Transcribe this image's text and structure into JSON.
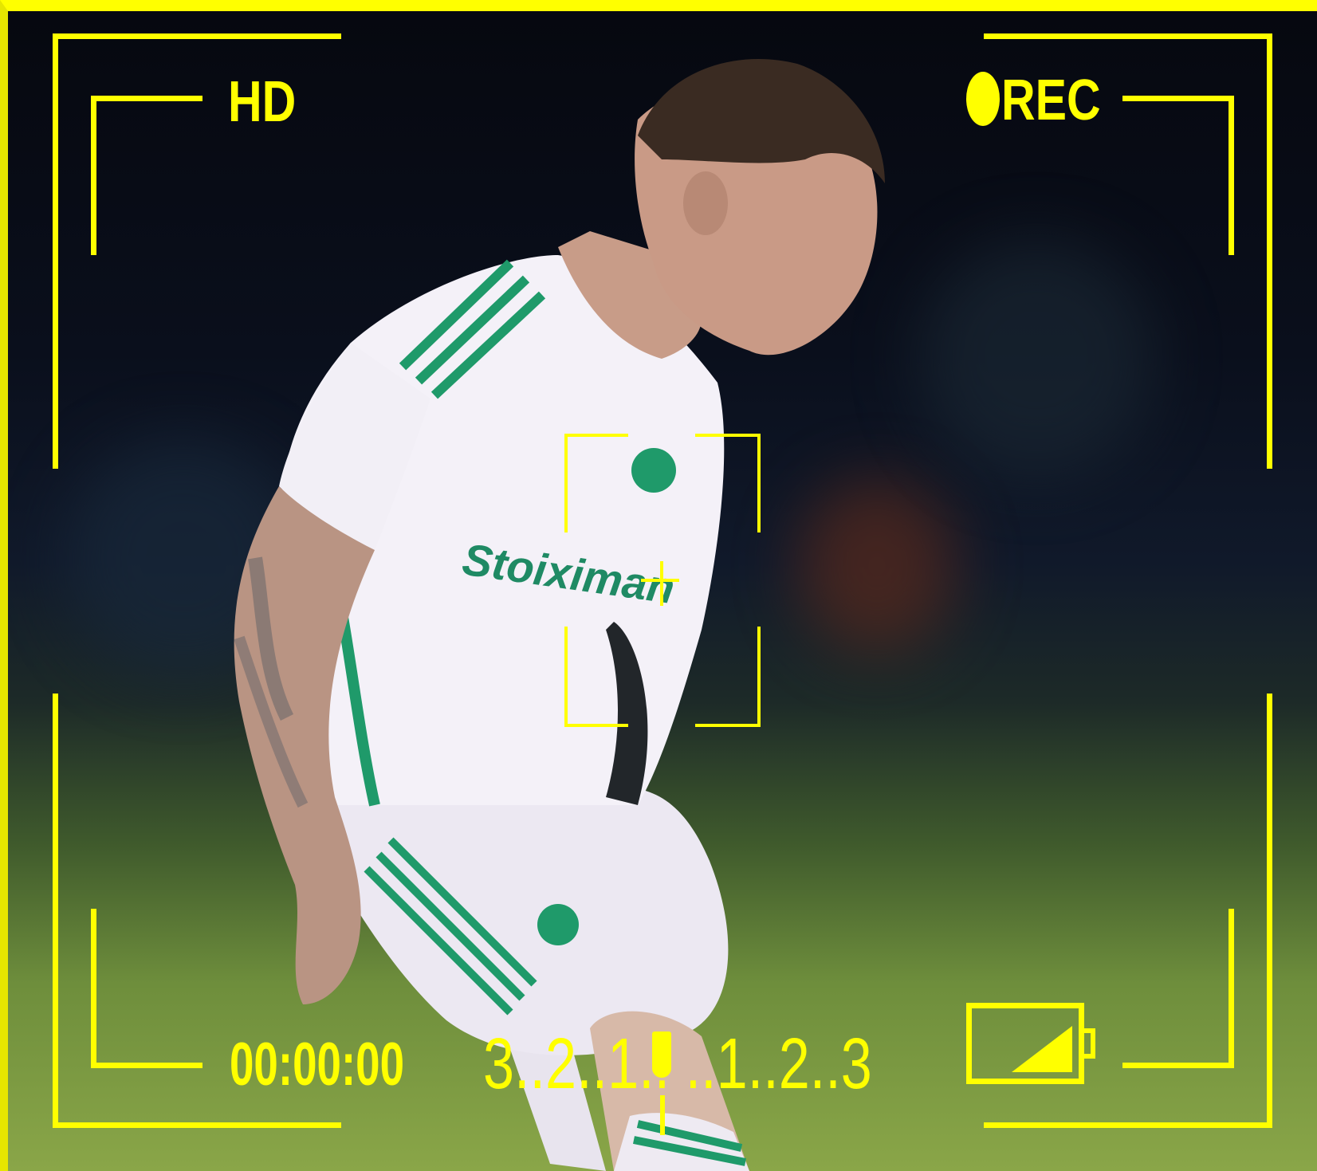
{
  "hud": {
    "quality_label": "HD",
    "rec_label": "REC",
    "timecode": "00:00:00",
    "exposure_scale": "3..2..1.. ..1..2..3"
  },
  "colors": {
    "hud": "#ffff00",
    "jersey": "#f4f1f8",
    "stripes": "#1f9a6a"
  },
  "icons": [
    "record-dot-icon",
    "battery-icon",
    "focus-crosshair-icon"
  ]
}
